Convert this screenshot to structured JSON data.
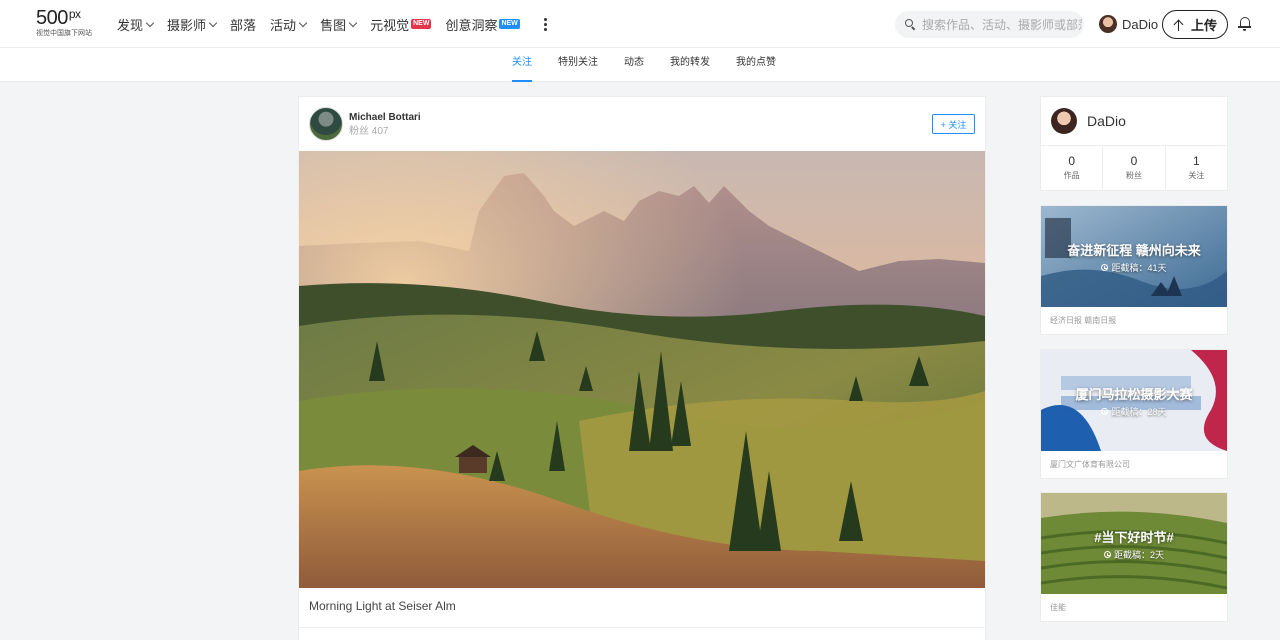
{
  "header": {
    "logo": {
      "mark": "500",
      "px": "px",
      "tagline": "视觉中国旗下网站"
    },
    "nav": [
      {
        "label": "发现",
        "dropdown": true
      },
      {
        "label": "摄影师",
        "dropdown": true
      },
      {
        "label": "部落",
        "dropdown": false
      },
      {
        "label": "活动",
        "dropdown": true
      },
      {
        "label": "售图",
        "dropdown": true
      },
      {
        "label": "元视觉",
        "badge": "NEW"
      },
      {
        "label": "创意洞察",
        "badge": "NEW"
      }
    ],
    "search_placeholder": "搜索作品、活动、摄影师或部落",
    "username": "DaDio",
    "upload_label": "上传"
  },
  "subnav": {
    "tabs": [
      "关注",
      "特别关注",
      "动态",
      "我的转发",
      "我的点赞"
    ],
    "active": "关注"
  },
  "feed": {
    "author_name": "Michael Bottari",
    "author_fans": "粉丝 407",
    "follow_label": "+ 关注",
    "caption": "Morning Light at Seiser Alm"
  },
  "profile": {
    "name": "DaDio",
    "stats": [
      {
        "num": "0",
        "label": "作品"
      },
      {
        "num": "0",
        "label": "粉丝"
      },
      {
        "num": "1",
        "label": "关注"
      }
    ]
  },
  "promos": [
    {
      "title": "奋进新征程 赣州向未来",
      "deadline": "距截稿：41天",
      "org": "经济日报 赣南日报"
    },
    {
      "title": "厦门马拉松摄影大赛",
      "deadline": "距截稿：28天",
      "org": "厦门文广体育有限公司"
    },
    {
      "title": "#当下好时节#",
      "deadline": "距截稿：2天",
      "org": "佳能"
    }
  ],
  "colors": {
    "accent": "#1f8fff",
    "badge_new": "#e8334a"
  }
}
